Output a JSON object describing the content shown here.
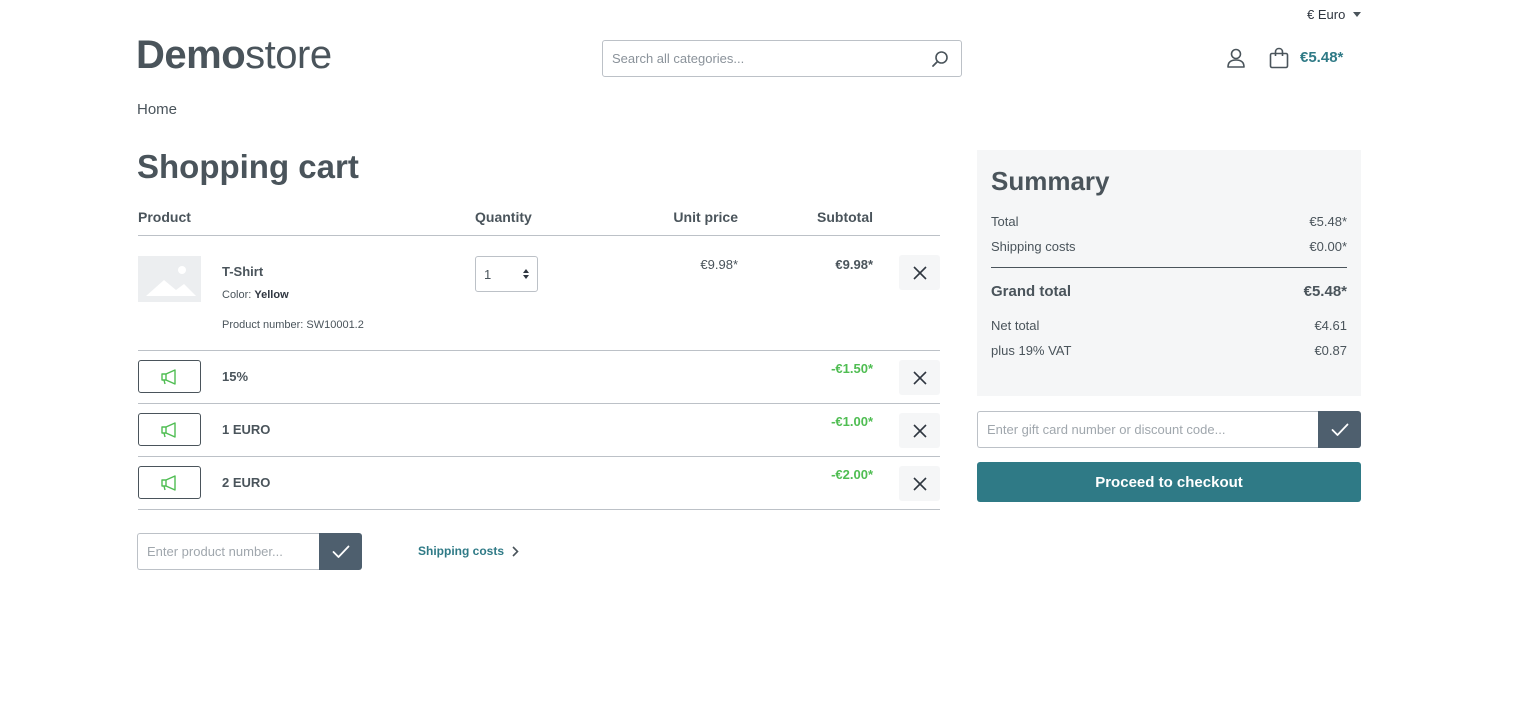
{
  "header": {
    "currency_label": "€ Euro",
    "logo_bold": "Demo",
    "logo_light": "store",
    "search_placeholder": "Search all categories...",
    "cart_total": "€5.48*"
  },
  "breadcrumb": {
    "home": "Home"
  },
  "page_title": "Shopping cart",
  "table": {
    "headers": {
      "product": "Product",
      "quantity": "Quantity",
      "unit_price": "Unit price",
      "subtotal": "Subtotal"
    },
    "item": {
      "name": "T-Shirt",
      "color_label": "Color: ",
      "color_value": "Yellow",
      "number_label": "Product number: SW10001.2",
      "quantity": "1",
      "unit_price": "€9.98*",
      "subtotal": "€9.98*"
    },
    "promotions": [
      {
        "label": "15%",
        "amount": "-€1.50*"
      },
      {
        "label": "1 EURO",
        "amount": "-€1.00*"
      },
      {
        "label": "2 EURO",
        "amount": "-€2.00*"
      }
    ]
  },
  "add_product": {
    "placeholder": "Enter product number..."
  },
  "shipping_costs_link": "Shipping costs",
  "summary": {
    "title": "Summary",
    "total_label": "Total",
    "total_value": "€5.48*",
    "shipping_label": "Shipping costs",
    "shipping_value": "€0.00*",
    "grand_total_label": "Grand total",
    "grand_total_value": "€5.48*",
    "net_total_label": "Net total",
    "net_total_value": "€4.61",
    "vat_label": "plus 19% VAT",
    "vat_value": "€0.87"
  },
  "gift_card": {
    "placeholder": "Enter gift card number or discount code..."
  },
  "checkout_label": "Proceed to checkout",
  "colors": {
    "accent": "#2f7a86",
    "text": "#4a545b",
    "promo_green": "#4fbd52",
    "button_dark": "#4e5f6e"
  }
}
